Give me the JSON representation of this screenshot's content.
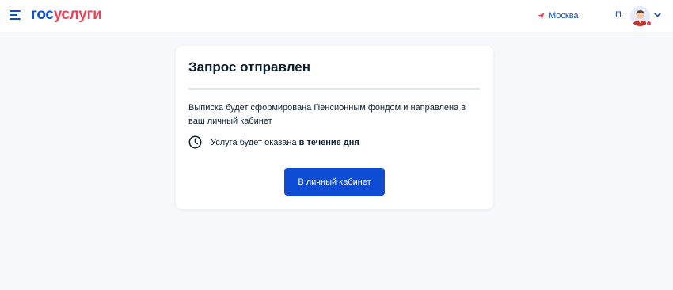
{
  "header": {
    "logo_part1": "гос",
    "logo_part2": "услуги",
    "location": "Москва",
    "user_initial": "П."
  },
  "card": {
    "title": "Запрос отправлен",
    "text": "Выписка будет сформирована Пенсионным фондом и направлена в ваш личный кабинет",
    "service_prefix": "Услуга будет оказана ",
    "service_term": "в течение дня",
    "button_label": "В личный кабинет"
  },
  "colors": {
    "brand_blue": "#0d4cd3",
    "brand_red": "#ee3f58",
    "page_background": "#f7f8fc",
    "text_dark": "#0b1f33"
  },
  "icons": [
    "menu-icon",
    "location-arrow-icon",
    "avatar",
    "chevron-down-icon",
    "clock-icon"
  ]
}
